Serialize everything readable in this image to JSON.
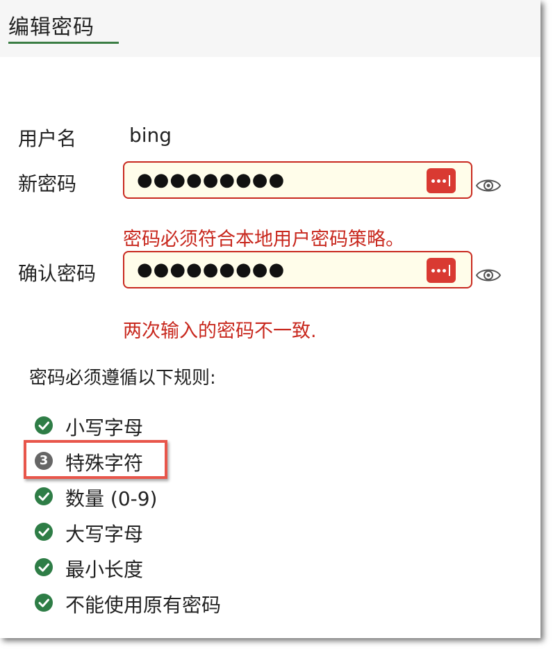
{
  "tab": {
    "title": "编辑密码",
    "underline_color": "#3a7d44"
  },
  "form": {
    "username_label": "用户名",
    "username_value": "bing",
    "new_password_label": "新密码",
    "new_password_masked": "●●●●●●●●●",
    "new_password_error": "密码必须符合本地用户密码策略。",
    "confirm_password_label": "确认密码",
    "confirm_password_masked": "●●●●●●●●●",
    "confirm_password_error": "两次输入的密码不一致."
  },
  "icons": {
    "password_manager": "password-manager-icon",
    "toggle_visibility": "eye-icon",
    "rule_ok": "check-circle-icon",
    "rule_pending": "number-badge-icon"
  },
  "rules": {
    "title": "密码必须遵循以下规则:",
    "items": [
      {
        "label": "小写字母",
        "status": "ok"
      },
      {
        "label": "特殊字符",
        "status": "pending",
        "badge": "3"
      },
      {
        "label": "数量 (0-9)",
        "status": "ok"
      },
      {
        "label": "大写字母",
        "status": "ok"
      },
      {
        "label": "最小长度",
        "status": "ok"
      },
      {
        "label": "不能使用原有密码",
        "status": "ok"
      }
    ]
  },
  "colors": {
    "error": "#c8281e",
    "field_bg": "#fffdea",
    "ok_badge": "#2e7d46",
    "pending_badge": "#666666",
    "highlight": "#e8564b",
    "pm_button": "#d93a32"
  }
}
